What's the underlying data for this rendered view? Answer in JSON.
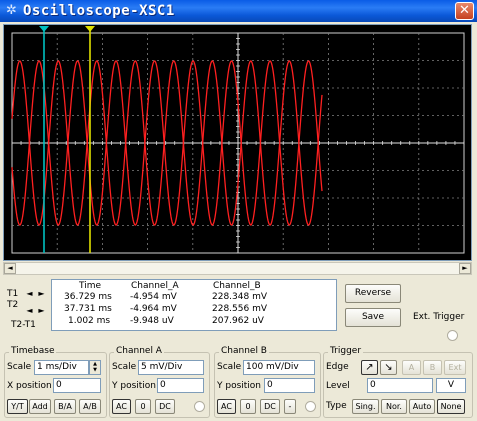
{
  "window": {
    "title": "Oscilloscope-XSC1",
    "close_glyph": "✕",
    "app_icon": "oscilloscope-icon"
  },
  "screen": {
    "background": "#000000",
    "grid_color": "#808080",
    "trace_color": "#FF2020",
    "cursor1_color": "#00C0C0",
    "cursor2_color": "#E0E000",
    "cursor1_marker": "1",
    "cursor2_marker": "2"
  },
  "scrollbar": {
    "left_arrow": "◄",
    "right_arrow": "►"
  },
  "cursors": {
    "t1_label": "T1",
    "t2_label": "T2",
    "t2t1_label": "T2-T1",
    "arrow_left": "◄",
    "arrow_right": "►",
    "headers": [
      "Time",
      "Channel_A",
      "Channel_B"
    ],
    "rows": [
      [
        "36.729 ms",
        "-4.954 mV",
        "228.348 mV"
      ],
      [
        "37.731 ms",
        "-4.964 mV",
        "228.556 mV"
      ],
      [
        "1.002 ms",
        "-9.948 uV",
        "207.962 uV"
      ]
    ]
  },
  "buttons": {
    "reverse": "Reverse",
    "save": "Save",
    "ext_trigger": "Ext. Trigger"
  },
  "timebase": {
    "title": "Timebase",
    "scale_label": "Scale",
    "scale_value": "1 ms/Div",
    "xpos_label": "X position",
    "xpos_value": "0",
    "modes": [
      "Y/T",
      "Add",
      "B/A",
      "A/B"
    ]
  },
  "channel_a": {
    "title": "Channel A",
    "scale_label": "Scale",
    "scale_value": "5 mV/Div",
    "ypos_label": "Y position",
    "ypos_value": "0",
    "coupling": [
      "AC",
      "0",
      "DC"
    ]
  },
  "channel_b": {
    "title": "Channel B",
    "scale_label": "Scale",
    "scale_value": "100 mV/Div",
    "ypos_label": "Y position",
    "ypos_value": "0",
    "coupling": [
      "AC",
      "0",
      "DC",
      "-"
    ]
  },
  "trigger": {
    "title": "Trigger",
    "edge_label": "Edge",
    "level_label": "Level",
    "level_value": "0",
    "level_unit": "V",
    "type_label": "Type",
    "edge_rising": "↗",
    "edge_falling": "↘",
    "sources": [
      "A",
      "B",
      "Ext"
    ],
    "types": [
      "Sing.",
      "Nor.",
      "Auto",
      "None"
    ]
  }
}
